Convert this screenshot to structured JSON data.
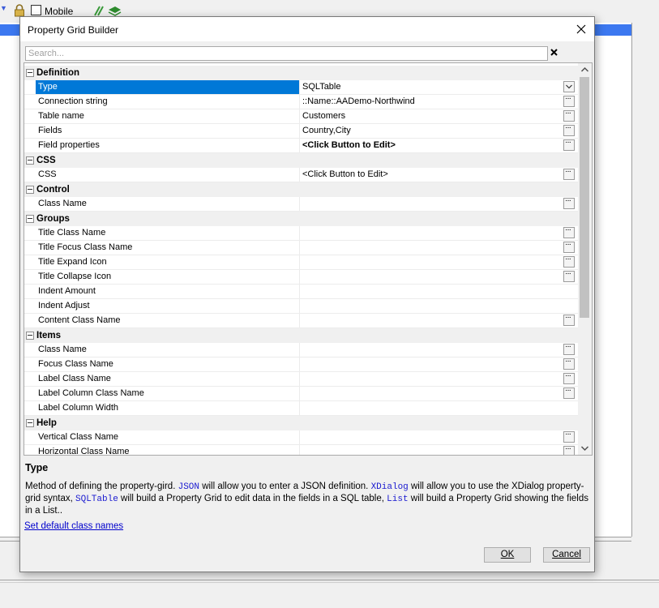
{
  "background": {
    "toolbar": {
      "mobile_checkbox_label": "Mobile"
    }
  },
  "dialog": {
    "title": "Property Grid Builder",
    "search": {
      "placeholder": "Search...",
      "value": ""
    },
    "categories": [
      {
        "label": "Definition",
        "properties": [
          {
            "name": "Type",
            "value": "SQLTable",
            "button": "dropdown",
            "selected": true
          },
          {
            "name": "Connection string",
            "value": "::Name::AADemo-Northwind",
            "button": "ellipsis"
          },
          {
            "name": "Table name",
            "value": "Customers",
            "button": "ellipsis"
          },
          {
            "name": "Fields",
            "value": "Country,City",
            "button": "ellipsis"
          },
          {
            "name": "Field properties",
            "value": "<Click Button to Edit>",
            "button": "ellipsis",
            "bold": true
          }
        ]
      },
      {
        "label": "CSS",
        "properties": [
          {
            "name": "CSS",
            "value": "<Click Button to Edit>",
            "button": "ellipsis"
          }
        ]
      },
      {
        "label": "Control",
        "properties": [
          {
            "name": "Class Name",
            "value": "",
            "button": "ellipsis"
          }
        ]
      },
      {
        "label": "Groups",
        "properties": [
          {
            "name": "Title Class Name",
            "value": "",
            "button": "ellipsis"
          },
          {
            "name": "Title Focus Class Name",
            "value": "",
            "button": "ellipsis"
          },
          {
            "name": "Title Expand Icon",
            "value": "",
            "button": "ellipsis"
          },
          {
            "name": "Title Collapse Icon",
            "value": "",
            "button": "ellipsis"
          },
          {
            "name": "Indent Amount",
            "value": "",
            "button": "none"
          },
          {
            "name": "Indent Adjust",
            "value": "",
            "button": "none"
          },
          {
            "name": "Content Class Name",
            "value": "",
            "button": "ellipsis"
          }
        ]
      },
      {
        "label": "Items",
        "properties": [
          {
            "name": "Class Name",
            "value": "",
            "button": "ellipsis"
          },
          {
            "name": "Focus Class Name",
            "value": "",
            "button": "ellipsis"
          },
          {
            "name": "Label Class Name",
            "value": "",
            "button": "ellipsis"
          },
          {
            "name": "Label Column Class Name",
            "value": "",
            "button": "ellipsis"
          },
          {
            "name": "Label Column Width",
            "value": "",
            "button": "none"
          }
        ]
      },
      {
        "label": "Help",
        "properties": [
          {
            "name": "Vertical Class Name",
            "value": "",
            "button": "ellipsis"
          },
          {
            "name": "Horizontal Class Name",
            "value": "",
            "button": "ellipsis"
          }
        ]
      }
    ],
    "help": {
      "title": "Type",
      "segments": [
        {
          "text": "Method of defining the property-gird. "
        },
        {
          "text": "JSON",
          "code": true
        },
        {
          "text": " will allow you to enter a JSON definition. "
        },
        {
          "text": "XDialog",
          "code": true
        },
        {
          "text": " will allow you to use the XDialog property-grid syntax, "
        },
        {
          "text": "SQLTable",
          "code": true
        },
        {
          "text": " will build a Property Grid to edit data in the fields in a SQL table, "
        },
        {
          "text": "List",
          "code": true
        },
        {
          "text": " will build a Property Grid showing the fields in a List.."
        }
      ]
    },
    "set_default_link": "Set default class names",
    "ok_label": "OK",
    "cancel_label": "Cancel"
  },
  "colors": {
    "selection": "#0078d7",
    "link": "#0000cc",
    "code_keyword": "#1b1bd0"
  }
}
